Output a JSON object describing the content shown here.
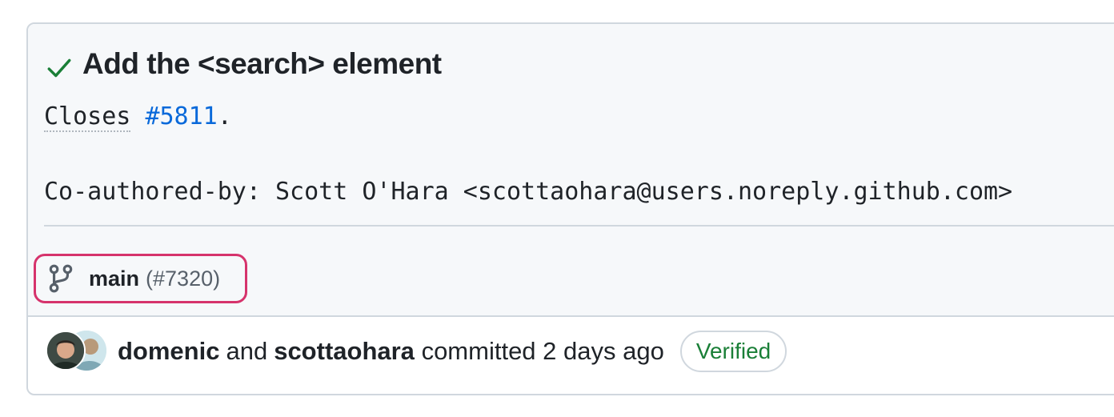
{
  "commit": {
    "title": "Add the <search> element",
    "body_closes_word": "Closes",
    "body_issue_link": "#5811",
    "body_period": ".",
    "body_coauthor": "Co-authored-by: Scott O'Hara <scottaohara@users.noreply.github.com>",
    "status_icon": "check-icon"
  },
  "branch": {
    "icon": "git-branch-icon",
    "name": "main",
    "pr": "(#7320)"
  },
  "meta": {
    "author": "domenic",
    "and_text": "and",
    "coauthor": "scottaohara",
    "committed_text": "committed 2 days ago",
    "verified_label": "Verified"
  },
  "colors": {
    "check": "#1a7f37",
    "link": "#0969da",
    "highlight_border": "#d6336c",
    "verified": "#1a7f37"
  }
}
